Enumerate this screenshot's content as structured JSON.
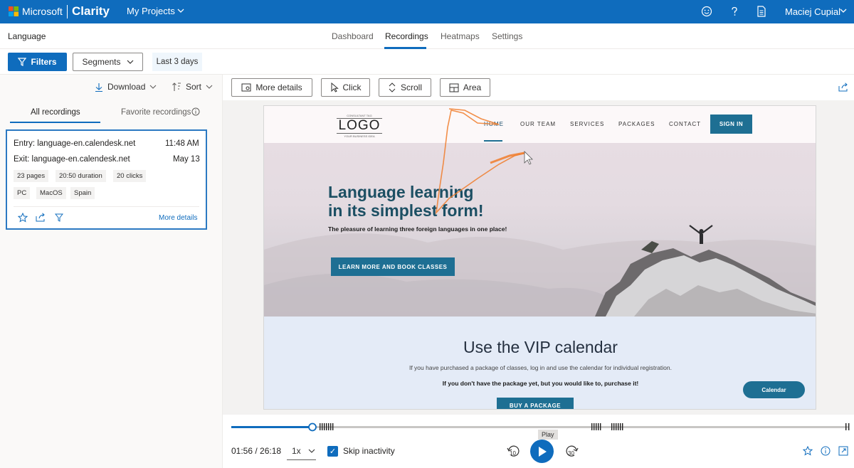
{
  "topbar": {
    "brand": "Microsoft",
    "product": "Clarity",
    "project_menu": "My Projects",
    "user_name": "Maciej Cupial"
  },
  "subheader": {
    "project_name": "Language",
    "tabs": [
      {
        "label": "Dashboard",
        "active": false
      },
      {
        "label": "Recordings",
        "active": true
      },
      {
        "label": "Heatmaps",
        "active": false
      },
      {
        "label": "Settings",
        "active": false
      }
    ]
  },
  "filters": {
    "filters_label": "Filters",
    "segments_label": "Segments",
    "date_range": "Last 3 days"
  },
  "sidebar": {
    "download_label": "Download",
    "sort_label": "Sort",
    "tabs": [
      {
        "label": "All recordings",
        "active": true
      },
      {
        "label": "Favorite recordings",
        "active": false
      }
    ],
    "card": {
      "entry": "Entry: language-en.calendesk.net",
      "entry_time": "11:48 AM",
      "exit": "Exit: language-en.calendesk.net",
      "exit_date": "May 13",
      "chips_row1": [
        "23 pages",
        "20:50 duration",
        "20 clicks"
      ],
      "chips_row2": [
        "PC",
        "MacOS",
        "Spain"
      ],
      "more_details": "More details"
    }
  },
  "toolbar": {
    "more_details": "More details",
    "click": "Click",
    "scroll": "Scroll",
    "area": "Area"
  },
  "site": {
    "logo_top": "CONSULTANT TAG",
    "logo": "LOGO",
    "logo_sub": "YOUR BUSINESS IDEA",
    "nav": [
      "HOME",
      "OUR TEAM",
      "SERVICES",
      "PACKAGES",
      "CONTACT"
    ],
    "sign_in": "SIGN IN",
    "hero_title_1": "Language learning",
    "hero_title_2": "in its simplest form!",
    "hero_subtitle": "The pleasure of learning three foreign languages in one place!",
    "hero_button": "LEARN MORE AND BOOK CLASSES",
    "vip_title": "Use the VIP calendar",
    "vip_text": "If you have purchased a package of classes, log in and use the calendar for individual registration.",
    "vip_text_bold": "If you don't have the package yet, but you would like to, purchase it!",
    "calendar_button": "Calendar",
    "buy_button": "BUY A PACKAGE"
  },
  "player": {
    "progress": 0.075,
    "time": "01:56 / 26:18",
    "speed": "1x",
    "skip_inactivity": "Skip inactivity",
    "skip_checked": true,
    "play_tooltip": "Play",
    "rewind_seconds": "10",
    "forward_seconds": "30"
  },
  "colors": {
    "brand_blue": "#0f6cbd",
    "site_button": "#1e6f93",
    "cursor_trail": "#f07d2b"
  }
}
